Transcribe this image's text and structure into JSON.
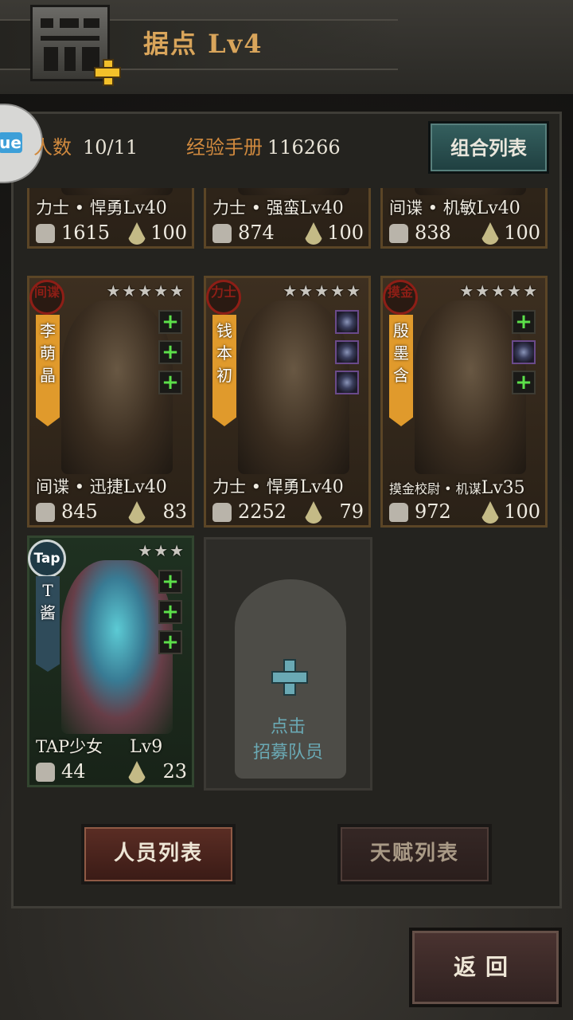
{
  "header": {
    "title": "据点  Lv4"
  },
  "stats": {
    "headcount_label": "人数",
    "headcount_value": "10/11",
    "exp_label": "经验手册",
    "exp_value": "116266",
    "combo_button": "组合列表"
  },
  "side_tab": {
    "icon_text": "ue"
  },
  "top_row": [
    {
      "label": "力士 • 悍勇",
      "level": "Lv40",
      "power": "1615",
      "morale": "100"
    },
    {
      "label": "力士 • 强蛮",
      "level": "Lv40",
      "power": "874",
      "morale": "100"
    },
    {
      "label": "间谍 • 机敏",
      "level": "Lv40",
      "power": "838",
      "morale": "100"
    }
  ],
  "cards": [
    {
      "name": "李萌晶",
      "badge": "间谍",
      "stars": "★★★★★",
      "label": "间谍 • 迅捷",
      "level": "Lv40",
      "power": "845",
      "morale": "83"
    },
    {
      "name": "钱本初",
      "badge": "力士",
      "stars": "★★★★★",
      "label": "力士 • 悍勇",
      "level": "Lv40",
      "power": "2252",
      "morale": "79"
    },
    {
      "name": "殷墨含",
      "badge": "摸金",
      "stars": "★★★★★",
      "label": "摸金校尉 • 机谋",
      "level": "Lv35",
      "power": "972",
      "morale": "100"
    },
    {
      "name": "T酱",
      "badge": "Tap",
      "stars": "★★★",
      "label": "TAP少女",
      "level": "Lv9",
      "power": "44",
      "morale": "23"
    }
  ],
  "recruit": {
    "line1": "点击",
    "line2": "招募队员"
  },
  "buttons": {
    "members": "人员列表",
    "talents": "天赋列表",
    "back": "返回"
  }
}
